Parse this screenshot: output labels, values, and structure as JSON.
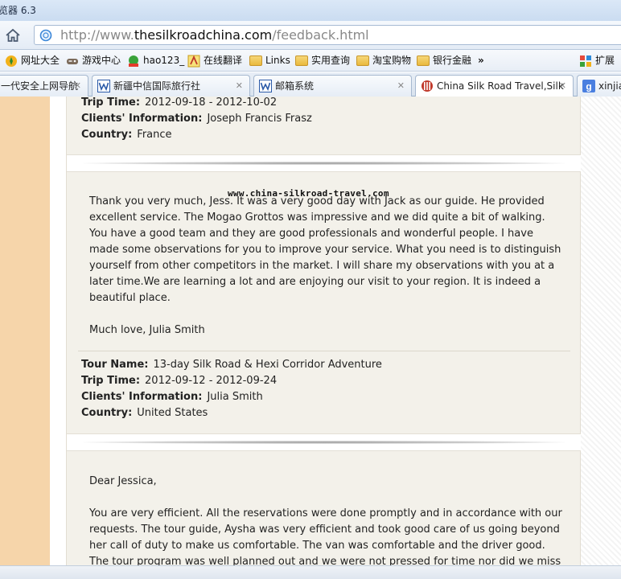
{
  "window": {
    "title": "览器 6.3"
  },
  "address_bar": {
    "url_prefix": "http://www.",
    "url_domain": "thesilkroadchina.com",
    "url_path": "/feedback.html"
  },
  "bookmarks": [
    {
      "label": "网址大全",
      "icon": "compass-icon"
    },
    {
      "label": "游戏中心",
      "icon": "gamepad-icon"
    },
    {
      "label": "hao123_",
      "icon": "hao123-icon"
    },
    {
      "label": "在线翻译",
      "icon": "translate-icon"
    },
    {
      "label": "Links",
      "icon": "folder-icon"
    },
    {
      "label": "实用查询",
      "icon": "folder-icon"
    },
    {
      "label": "淘宝购物",
      "icon": "folder-icon"
    },
    {
      "label": "银行金融",
      "icon": "folder-icon"
    }
  ],
  "bookmarks_more": "»",
  "extensions_label": "扩展",
  "tabs": [
    {
      "label": "一代安全上网导航",
      "close": "✕"
    },
    {
      "label": "新疆中信国际旅行社",
      "close": "✕"
    },
    {
      "label": "邮箱系统",
      "close": "✕"
    },
    {
      "label": "China Silk Road Travel,Silk",
      "close": "✕"
    },
    {
      "label": "xinjiang",
      "close": ""
    }
  ],
  "review1": {
    "trip_time_label": "Trip Time:",
    "trip_time": "2012-09-18 - 2012-10-02",
    "clients_label": "Clients' Information:",
    "clients": "Joseph Francis Frasz",
    "country_label": "Country:",
    "country": "France"
  },
  "review2": {
    "body": "Thank you very much, Jess. It was a very good day with Jack as our guide. He provided excellent service. The Mogao Grottos was impressive and we did quite a bit of walking. You have a good team and they are good professionals and wonderful people. I have made some observations for you to improve your service. What you need is to distinguish yourself from other competitors in the market. I will share my observations with you at a later time.We are learning a lot and are enjoying our visit to your region. It is indeed a beautiful place.",
    "signoff": "Much love, Julia Smith",
    "tour_name_label": "Tour Name:",
    "tour_name": "13-day Silk Road & Hexi Corridor Adventure",
    "trip_time_label": "Trip Time:",
    "trip_time": "2012-09-12 - 2012-09-24",
    "clients_label": "Clients' Information:",
    "clients": "Julia Smith",
    "country_label": "Country:",
    "country": "United States"
  },
  "review3": {
    "greeting": "Dear Jessica,",
    "body": "You are very efficient.  All the reservations were done promptly and in accordance with our requests. The tour guide, Aysha was very efficient and took good care of us going beyond her call of duty to make us comfortable. The van was comfortable and the driver good.  The tour program was well planned out and we were not pressed for time nor did we miss out"
  },
  "watermark": "www.china-silkroad-travel.com"
}
